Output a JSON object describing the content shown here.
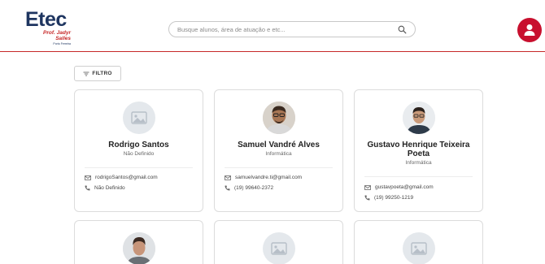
{
  "header": {
    "logo": {
      "main": "Etec",
      "line1": "Prof. Jadyr",
      "line2": "Salles",
      "line3": "Porto Ferreira"
    },
    "search": {
      "placeholder": "Busque alunos, área de atuação e etc..."
    },
    "icons": {
      "search": "search-icon",
      "user": "user-icon"
    },
    "colors": {
      "accent": "#c62828",
      "avatar_bg": "#c8102e",
      "brand_blue": "#1e3560"
    }
  },
  "filter": {
    "label": "FILTRO",
    "icon": "filter-icon"
  },
  "cards": [
    {
      "name": "Rodrigo Santos",
      "area": "Não Definido",
      "email": "rodrigoSantos@gmail.com",
      "phone": "Não Definido",
      "photo": "placeholder-image-icon"
    },
    {
      "name": "Samuel Vandré Alves",
      "area": "Informática",
      "email": "samuelvandre.ti@gmail.com",
      "phone": "(19) 99640-2372",
      "photo": "person-photo"
    },
    {
      "name": "Gustavo Henrique Teixeira Poeta",
      "area": "Informática",
      "email": "gustavpoeta@gmail.com",
      "phone": "(19) 99250-1219",
      "photo": "person-photo"
    },
    {
      "photo": "person-photo"
    },
    {
      "photo": "placeholder-image-icon"
    },
    {
      "photo": "placeholder-image-icon"
    }
  ]
}
